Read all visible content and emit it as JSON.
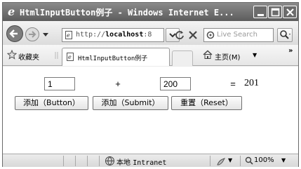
{
  "window": {
    "title": "HtmlInputButton例子 - Windows Internet E...",
    "caption_buttons": [
      "minimize",
      "maximize",
      "close"
    ]
  },
  "navigation": {
    "address_prefix": "http://",
    "address_host": "localhost",
    "address_suffix": ":8",
    "search_placeholder": "Live Search"
  },
  "favorites": {
    "label": "收藏夹"
  },
  "tab": {
    "title": "HtmlInputButton例子"
  },
  "home": {
    "label": "主页(M)"
  },
  "form": {
    "input1_value": "1",
    "operator": "+",
    "input2_value": "200",
    "equals": "=",
    "result": "201",
    "buttons": [
      "添加（Button）",
      "添加（Submit）",
      "重置（Reset）"
    ]
  },
  "status": {
    "zone_cn": "本地",
    "zone_en": "Intranet",
    "zoom": "100%"
  },
  "icons": {
    "title": "ie-logo-icon",
    "back": "back-arrow-icon",
    "forward": "forward-arrow-icon",
    "page": "page-icon",
    "refresh": "refresh-icon",
    "stop": "stop-icon",
    "search": "search-icon",
    "favorites": "star-icon",
    "home": "home-icon",
    "globe": "globe-icon",
    "zoom": "magnifier-icon"
  }
}
